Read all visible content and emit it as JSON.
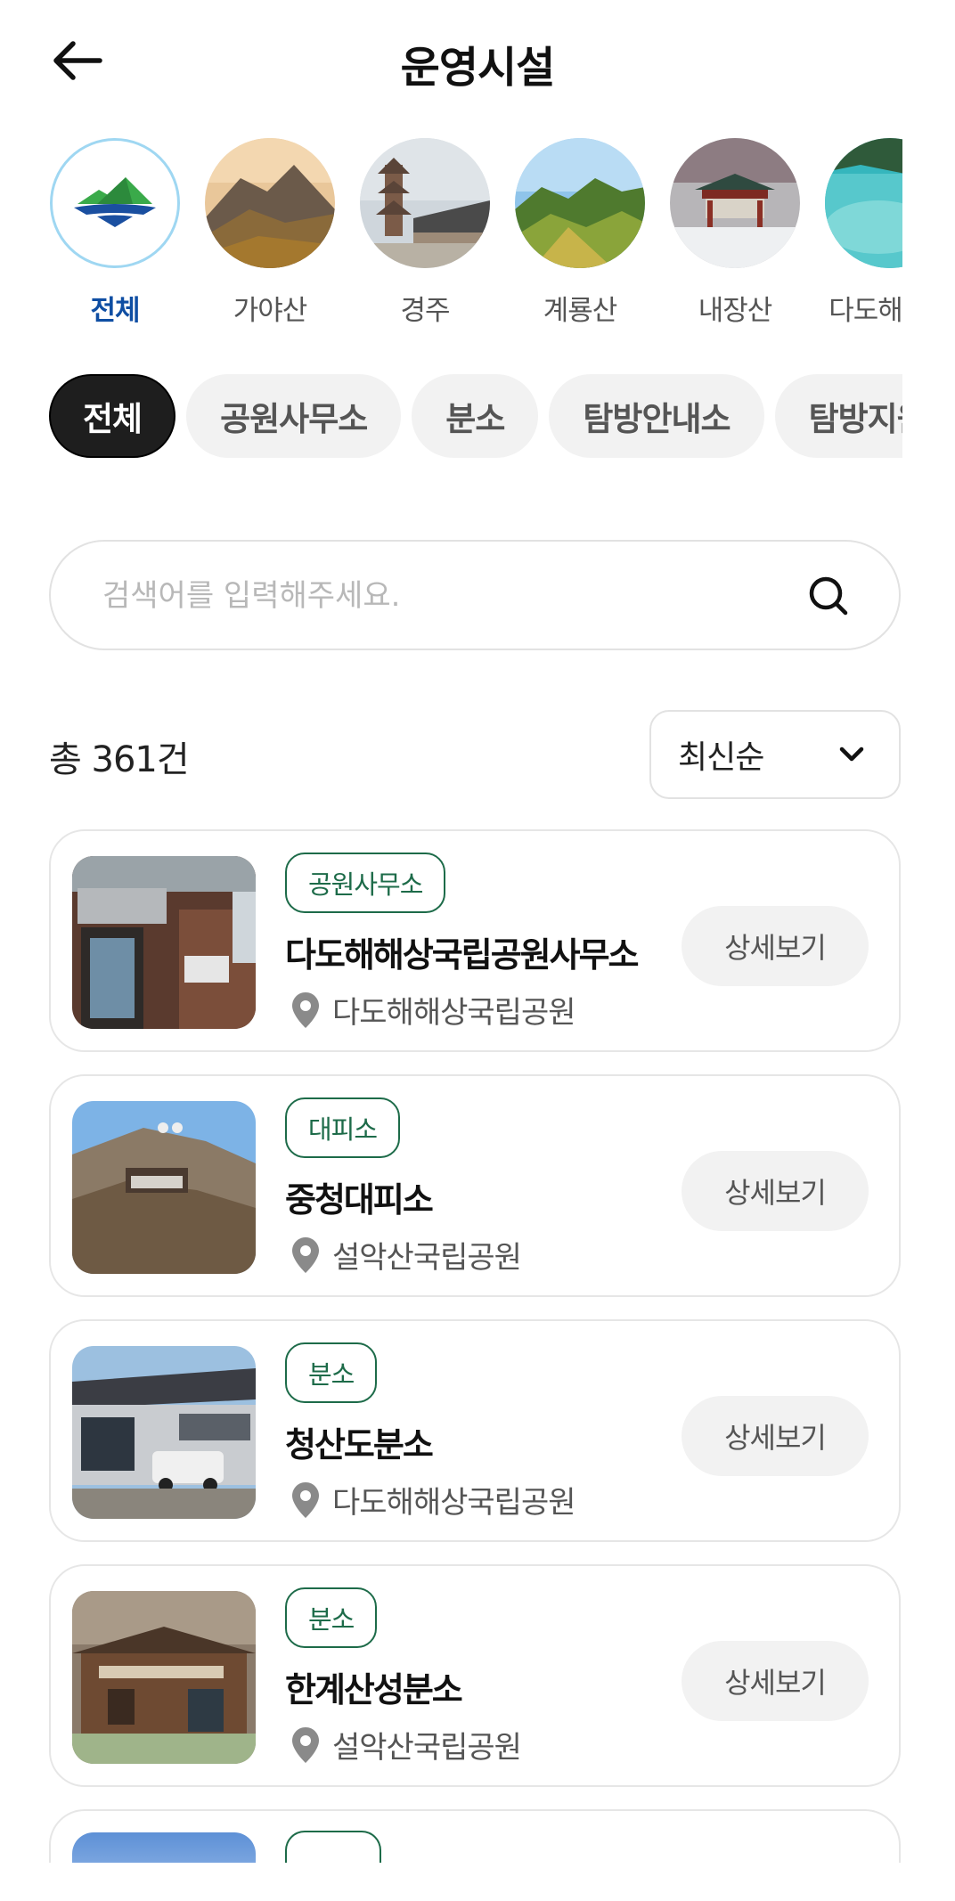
{
  "header": {
    "title": "운영시설"
  },
  "parks": [
    {
      "label": "전체",
      "active": true
    },
    {
      "label": "가야산"
    },
    {
      "label": "경주"
    },
    {
      "label": "계룡산"
    },
    {
      "label": "내장산"
    },
    {
      "label": "다도해해상"
    }
  ],
  "categories": [
    {
      "label": "전체",
      "active": true
    },
    {
      "label": "공원사무소"
    },
    {
      "label": "분소"
    },
    {
      "label": "탐방안내소"
    },
    {
      "label": "탐방지원센터"
    }
  ],
  "search": {
    "placeholder": "검색어를 입력해주세요."
  },
  "results": {
    "count_text": "총 361건"
  },
  "sort": {
    "selected": "최신순"
  },
  "facilities": [
    {
      "tag": "공원사무소",
      "name": "다도해해상국립공원사무소",
      "park": "다도해해상국립공원",
      "button": "상세보기"
    },
    {
      "tag": "대피소",
      "name": "중청대피소",
      "park": "설악산국립공원",
      "button": "상세보기"
    },
    {
      "tag": "분소",
      "name": "청산도분소",
      "park": "다도해해상국립공원",
      "button": "상세보기"
    },
    {
      "tag": "분소",
      "name": "한계산성분소",
      "park": "설악산국립공원",
      "button": "상세보기"
    }
  ],
  "colors": {
    "accent_blue": "#0f4ea3",
    "tag_green": "#1d6b49",
    "pill_dark": "#1e1e1e",
    "pill_light": "#f2f2f2"
  }
}
